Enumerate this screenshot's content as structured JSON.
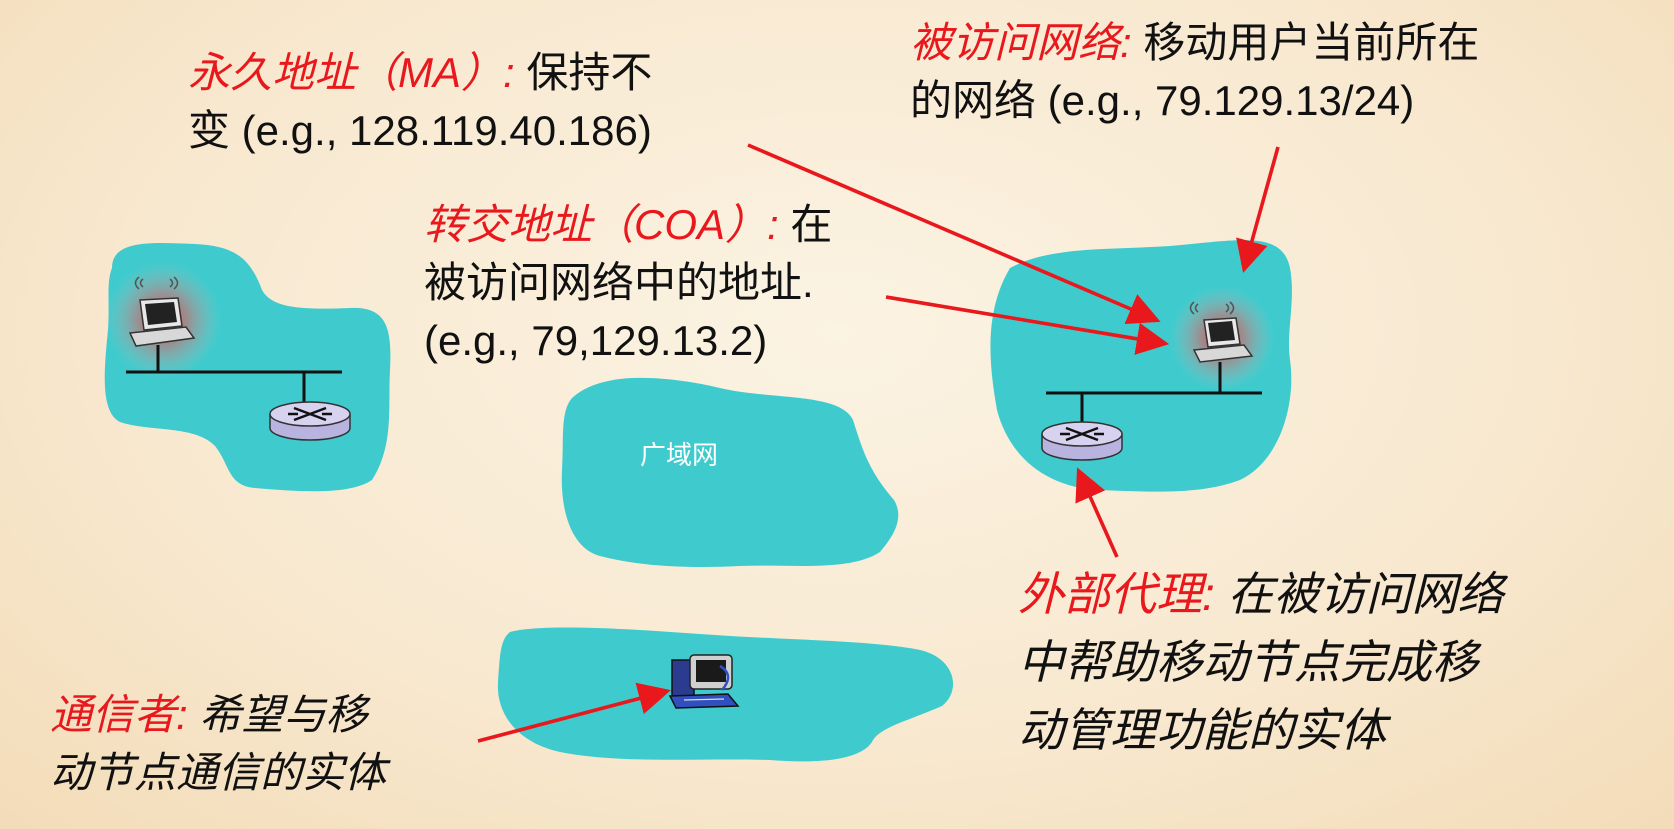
{
  "wan_label": "广域网",
  "labels": {
    "ma": {
      "term": "永久地址（MA）:",
      "text1": " 保持不",
      "text2": "变 (e.g., 128.119.40.186)"
    },
    "coa": {
      "term": "转交地址（COA）:",
      "text1": " 在",
      "text2": "被访问网络中的地址.",
      "text3": "(e.g., 79,129.13.2)"
    },
    "visited": {
      "term": "被访问网络:",
      "text1": " 移动用户当前所在",
      "text2": "的网络 (e.g., 79.129.13/24)"
    },
    "foreign_agent": {
      "term": "外部代理:",
      "text1": " 在被访问网络",
      "text2": "中帮助移动节点完成移",
      "text3": "动管理功能的实体"
    },
    "correspondent": {
      "term": "通信者:",
      "text1": " 希望与移",
      "text2": "动节点通信的实体"
    }
  },
  "icons": [
    "laptop-icon",
    "router-icon",
    "desktop-computer-icon",
    "wireless-signal-icon"
  ],
  "colors": {
    "network": "#3fcbcd",
    "accent": "#e8181c",
    "text": "#111111",
    "router": "#c8c3e8"
  }
}
